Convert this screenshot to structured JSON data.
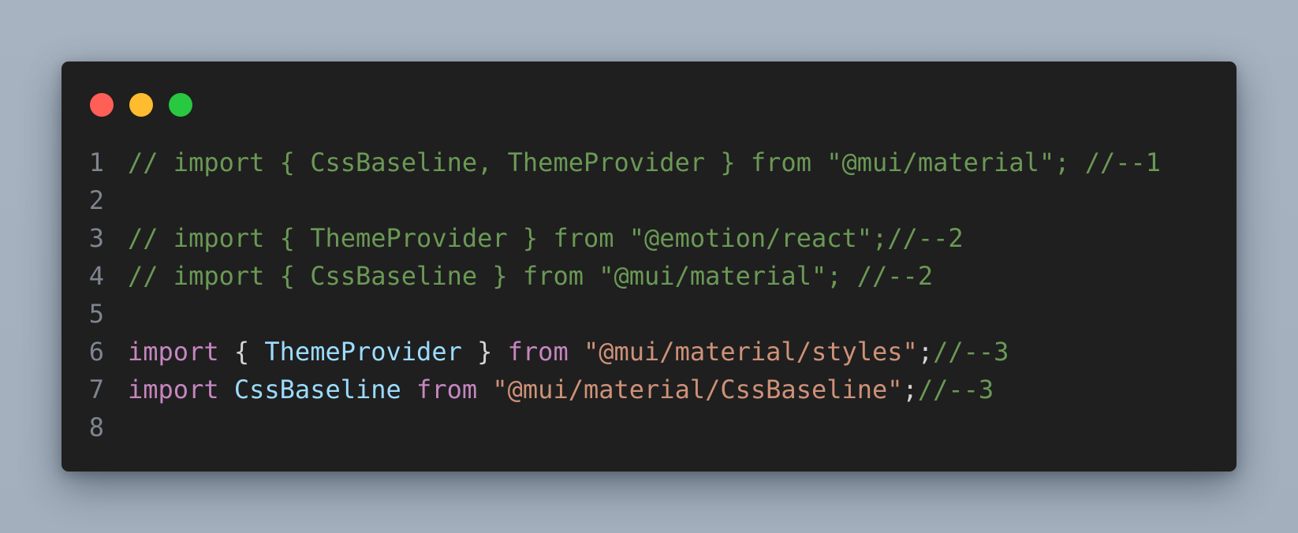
{
  "window": {
    "buttons": [
      {
        "name": "close",
        "color": "#ff5f57"
      },
      {
        "name": "minimize",
        "color": "#febc2e"
      },
      {
        "name": "maximize",
        "color": "#28c840"
      }
    ]
  },
  "colors": {
    "background": "#a5b1bf",
    "editor": "#1f1f1f",
    "comment": "#6a9955",
    "keyword": "#c586c0",
    "identifier": "#9cdcfe",
    "string": "#ce9178",
    "punctuation": "#d4d4d4",
    "line_number": "#7e8590"
  },
  "code": {
    "lines": [
      {
        "number": "1",
        "tokens": [
          {
            "type": "comment",
            "text": "// import { CssBaseline, ThemeProvider } from \"@mui/material\"; //--1"
          }
        ]
      },
      {
        "number": "2",
        "tokens": []
      },
      {
        "number": "3",
        "tokens": [
          {
            "type": "comment",
            "text": "// import { ThemeProvider } from \"@emotion/react\";//--2"
          }
        ]
      },
      {
        "number": "4",
        "tokens": [
          {
            "type": "comment",
            "text": "// import { CssBaseline } from \"@mui/material\"; //--2"
          }
        ]
      },
      {
        "number": "5",
        "tokens": []
      },
      {
        "number": "6",
        "tokens": [
          {
            "type": "keyword",
            "text": "import"
          },
          {
            "type": "punct",
            "text": " { "
          },
          {
            "type": "ident",
            "text": "ThemeProvider"
          },
          {
            "type": "punct",
            "text": " } "
          },
          {
            "type": "keyword",
            "text": "from"
          },
          {
            "type": "punct",
            "text": " "
          },
          {
            "type": "string",
            "text": "\"@mui/material/styles\""
          },
          {
            "type": "punct",
            "text": ";"
          },
          {
            "type": "comment",
            "text": "//--3"
          }
        ]
      },
      {
        "number": "7",
        "tokens": [
          {
            "type": "keyword",
            "text": "import"
          },
          {
            "type": "punct",
            "text": " "
          },
          {
            "type": "ident",
            "text": "CssBaseline"
          },
          {
            "type": "punct",
            "text": " "
          },
          {
            "type": "keyword",
            "text": "from"
          },
          {
            "type": "punct",
            "text": " "
          },
          {
            "type": "string",
            "text": "\"@mui/material/CssBaseline\""
          },
          {
            "type": "punct",
            "text": ";"
          },
          {
            "type": "comment",
            "text": "//--3"
          }
        ]
      },
      {
        "number": "8",
        "tokens": []
      }
    ]
  }
}
